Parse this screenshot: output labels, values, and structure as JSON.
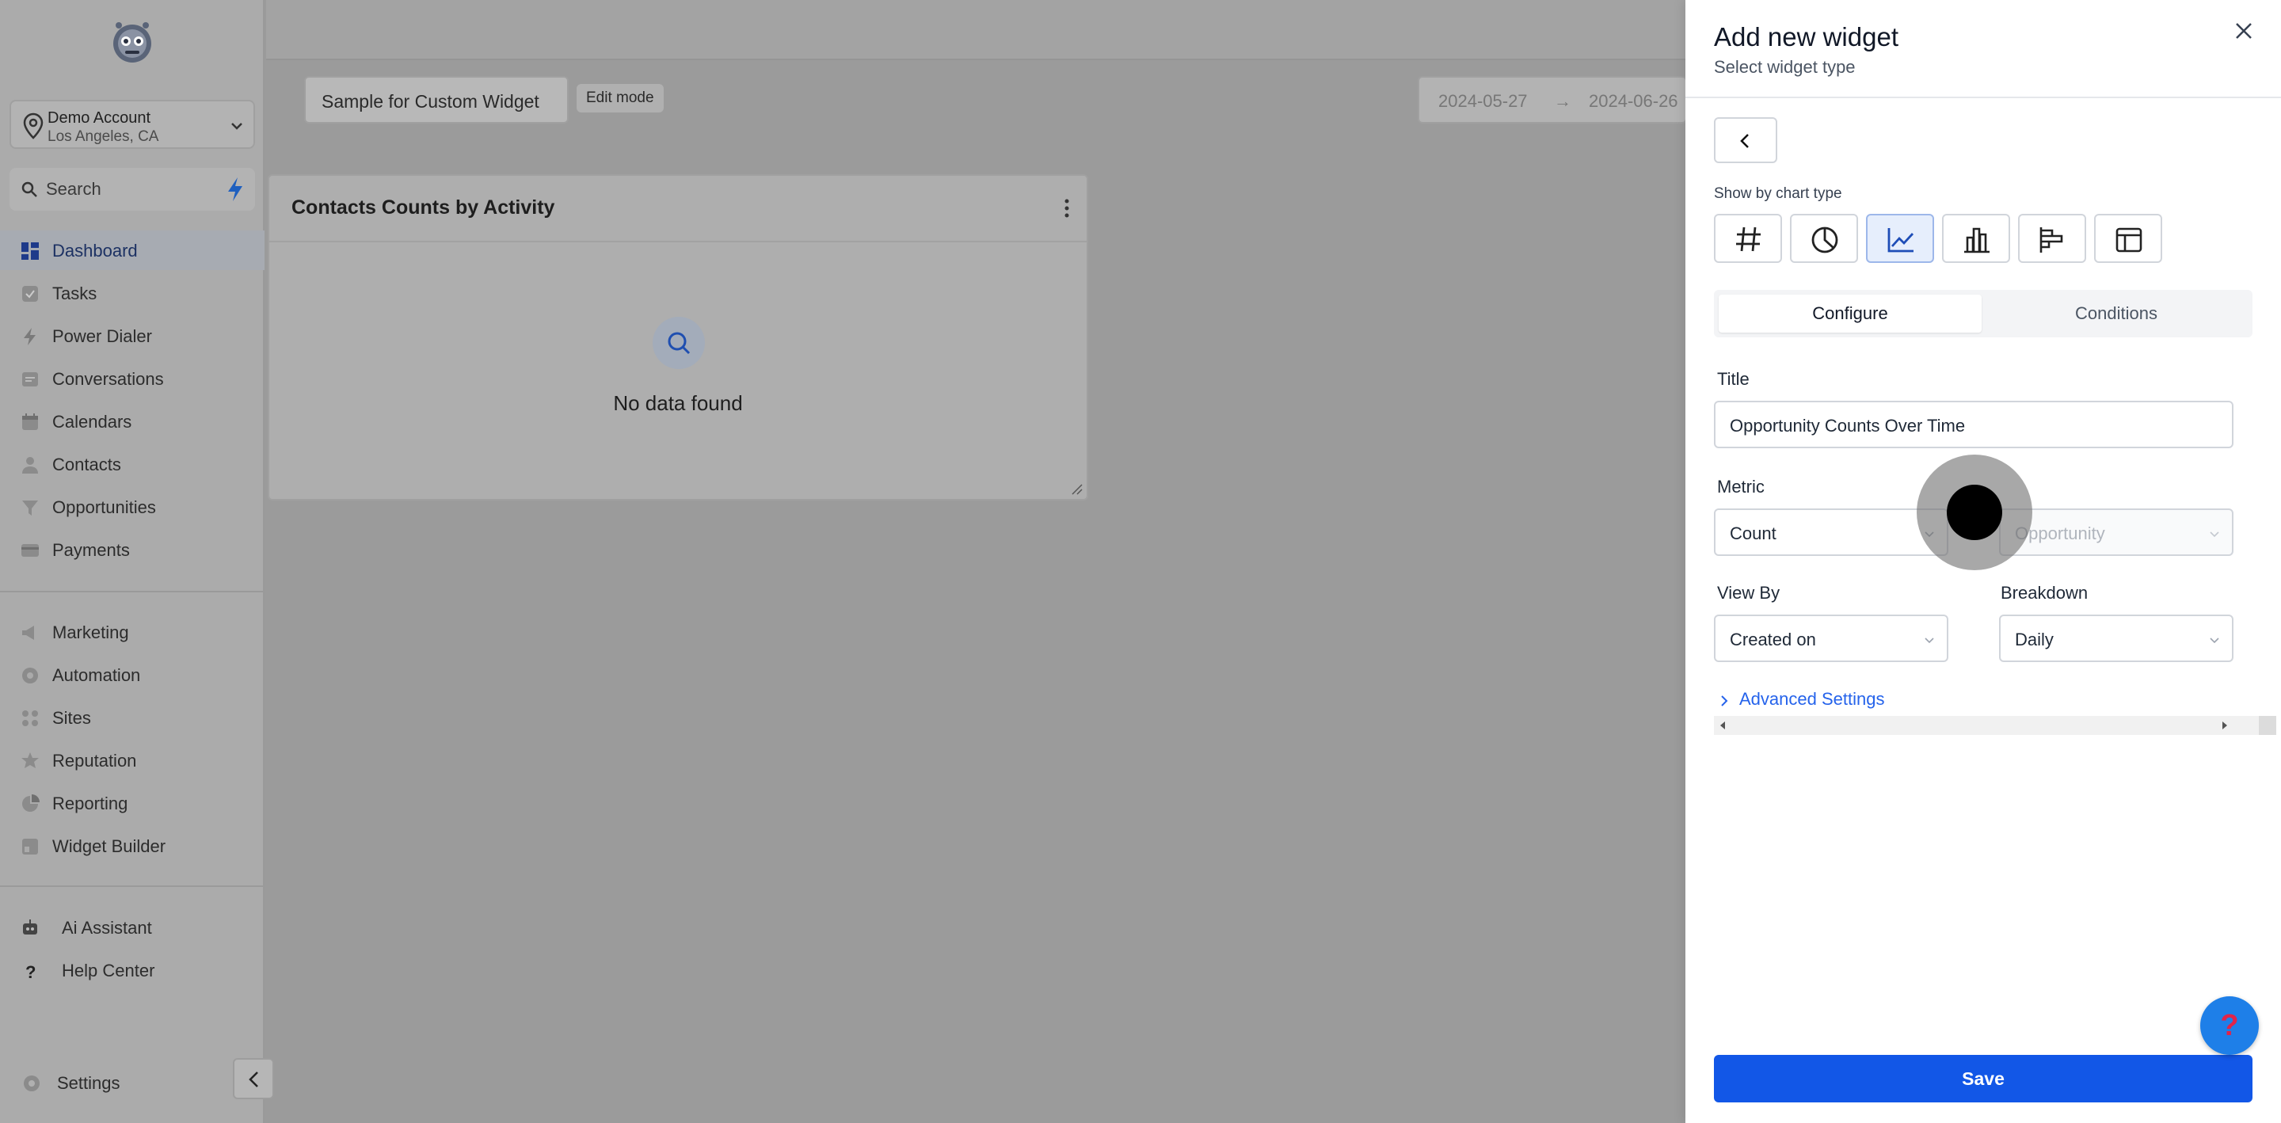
{
  "sidebar": {
    "account": {
      "name": "Demo Account",
      "location": "Los Angeles, CA"
    },
    "search_placeholder": "Search",
    "items": [
      {
        "label": "Dashboard",
        "icon": "dashboard-icon"
      },
      {
        "label": "Tasks",
        "icon": "tasks-icon"
      },
      {
        "label": "Power Dialer",
        "icon": "bolt-icon"
      },
      {
        "label": "Conversations",
        "icon": "chat-icon"
      },
      {
        "label": "Calendars",
        "icon": "calendar-icon"
      },
      {
        "label": "Contacts",
        "icon": "person-icon"
      },
      {
        "label": "Opportunities",
        "icon": "funnel-icon"
      },
      {
        "label": "Payments",
        "icon": "card-icon"
      },
      {
        "label": "Marketing",
        "icon": "megaphone-icon"
      },
      {
        "label": "Automation",
        "icon": "automation-icon"
      },
      {
        "label": "Sites",
        "icon": "globe-icon"
      },
      {
        "label": "Reputation",
        "icon": "star-icon"
      },
      {
        "label": "Reporting",
        "icon": "pie-icon"
      },
      {
        "label": "Widget Builder",
        "icon": "widget-icon"
      }
    ],
    "bottom": [
      {
        "label": "Ai Assistant",
        "icon": "robot-icon"
      },
      {
        "label": "Help Center",
        "icon": "question-icon"
      }
    ],
    "settings_label": "Settings"
  },
  "toolbar": {
    "dashboard_name": "Sample for Custom Widget",
    "edit_mode_label": "Edit mode",
    "date_from": "2024-05-27",
    "date_arrow": "→",
    "date_to": "2024-06-26"
  },
  "card": {
    "title": "Contacts Counts by Activity",
    "empty_text": "No data found"
  },
  "panel": {
    "title": "Add new widget",
    "subtitle": "Select widget type",
    "chart_type_label": "Show by chart type",
    "chart_types": [
      {
        "icon": "hash-icon",
        "selected": false
      },
      {
        "icon": "pie-chart-icon",
        "selected": false
      },
      {
        "icon": "line-chart-icon",
        "selected": true
      },
      {
        "icon": "bar-chart-icon",
        "selected": false
      },
      {
        "icon": "horizontal-bar-icon",
        "selected": false
      },
      {
        "icon": "table-icon",
        "selected": false
      }
    ],
    "tabs": {
      "configure": "Configure",
      "conditions": "Conditions"
    },
    "form": {
      "title_label": "Title",
      "title_value": "Opportunity Counts Over Time",
      "metric_label": "Metric",
      "metric_value": "Count",
      "metric_object": "Opportunity",
      "view_by_label": "View By",
      "view_by_value": "Created on",
      "breakdown_label": "Breakdown",
      "breakdown_value": "Daily",
      "advanced_label": "Advanced Settings"
    },
    "save_label": "Save",
    "help_symbol": "?"
  },
  "colors": {
    "accent": "#1257e7",
    "link": "#2563eb",
    "selected_chart_bg": "#e6eefc",
    "overlay": "#9b9b9b"
  }
}
